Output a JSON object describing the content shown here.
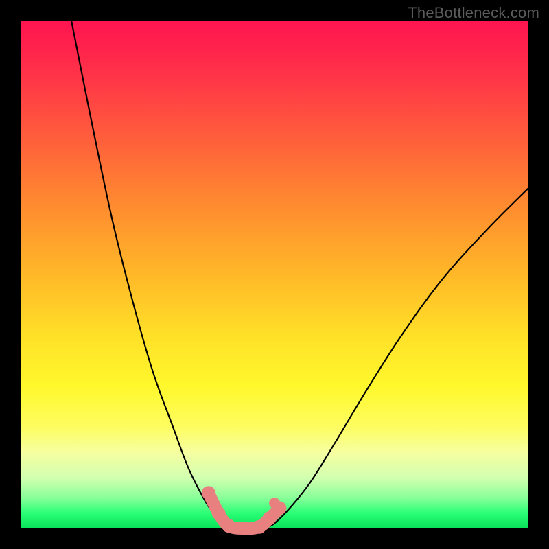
{
  "watermark": "TheBottleneck.com",
  "chart_data": {
    "type": "line",
    "title": "",
    "xlabel": "",
    "ylabel": "",
    "xlim": [
      0,
      100
    ],
    "ylim": [
      0,
      100
    ],
    "series": [
      {
        "name": "left-curve",
        "x": [
          10,
          14,
          18,
          22,
          26,
          30,
          33,
          36,
          38,
          40,
          41
        ],
        "y": [
          100,
          80,
          61,
          45,
          31,
          20,
          12,
          6,
          3,
          1,
          0
        ]
      },
      {
        "name": "right-curve",
        "x": [
          48,
          50,
          53,
          57,
          62,
          68,
          75,
          83,
          92,
          100
        ],
        "y": [
          0,
          1,
          4,
          9,
          17,
          27,
          38,
          49,
          59,
          67
        ]
      }
    ],
    "highlighted_band": {
      "name": "optimal-range",
      "points": [
        {
          "x": 37,
          "y": 7
        },
        {
          "x": 39,
          "y": 3
        },
        {
          "x": 41,
          "y": 0.5
        },
        {
          "x": 44,
          "y": 0
        },
        {
          "x": 47,
          "y": 0.3
        },
        {
          "x": 49,
          "y": 2
        },
        {
          "x": 51,
          "y": 4
        }
      ],
      "isolated_point": {
        "x": 50,
        "y": 5
      }
    },
    "colors": {
      "curve": "#000000",
      "highlight": "#e88080",
      "gradient_top": "#ff1450",
      "gradient_mid": "#ffe028",
      "gradient_bottom": "#08e25a"
    }
  }
}
